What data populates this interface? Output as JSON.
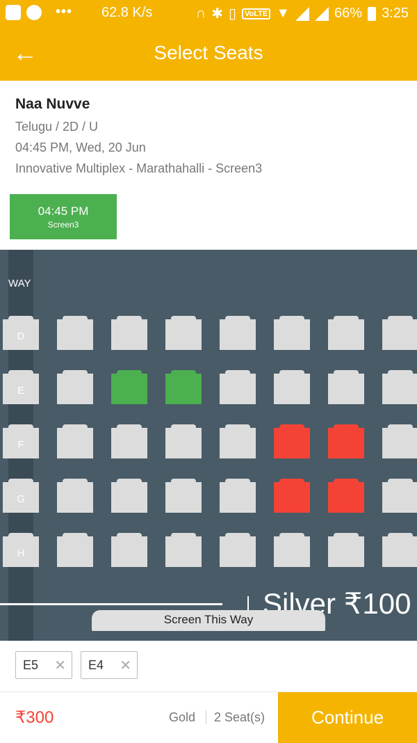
{
  "status_bar": {
    "net_speed": "62.8 K/s",
    "volte": "VoLTE",
    "battery": "66%",
    "time": "3:25"
  },
  "header": {
    "back_icon": "arrow-left-icon",
    "title": "Select Seats"
  },
  "movie": {
    "title": "Naa Nuvve",
    "language_format": "Telugu / 2D / U",
    "datetime": "04:45 PM, Wed, 20 Jun",
    "venue": "Innovative Multiplex - Marathahalli - Screen3"
  },
  "showtime": {
    "time": "04:45 PM",
    "screen": "Screen3"
  },
  "seat_map": {
    "way_label": "WAY",
    "section_label": "Silver ₹100",
    "screen_label": "Screen This Way",
    "rows": [
      {
        "label": "D",
        "seats": [
          "available",
          "available",
          "available",
          "available",
          "available",
          "available",
          "available",
          "available"
        ]
      },
      {
        "label": "E",
        "seats": [
          "available",
          "available",
          "selected",
          "selected",
          "available",
          "available",
          "available",
          "available"
        ]
      },
      {
        "label": "F",
        "seats": [
          "available",
          "available",
          "available",
          "available",
          "available",
          "sold",
          "sold",
          "available"
        ]
      },
      {
        "label": "G",
        "seats": [
          "available",
          "available",
          "available",
          "available",
          "available",
          "sold",
          "sold",
          "available"
        ]
      },
      {
        "label": "H",
        "seats": [
          "available",
          "available",
          "available",
          "available",
          "available",
          "available",
          "available",
          "available"
        ]
      }
    ],
    "colors": {
      "available": "#dcdcdc",
      "selected": "#4caf50",
      "sold": "#f44336",
      "background": "#485b67"
    }
  },
  "selected_seats": [
    {
      "label": "E5",
      "remove_icon": "close-icon"
    },
    {
      "label": "E4",
      "remove_icon": "close-icon"
    }
  ],
  "footer": {
    "total": "₹300",
    "class": "Gold",
    "seat_count": "2 Seat(s)",
    "continue_label": "Continue"
  },
  "accent_color": "#f5b400"
}
